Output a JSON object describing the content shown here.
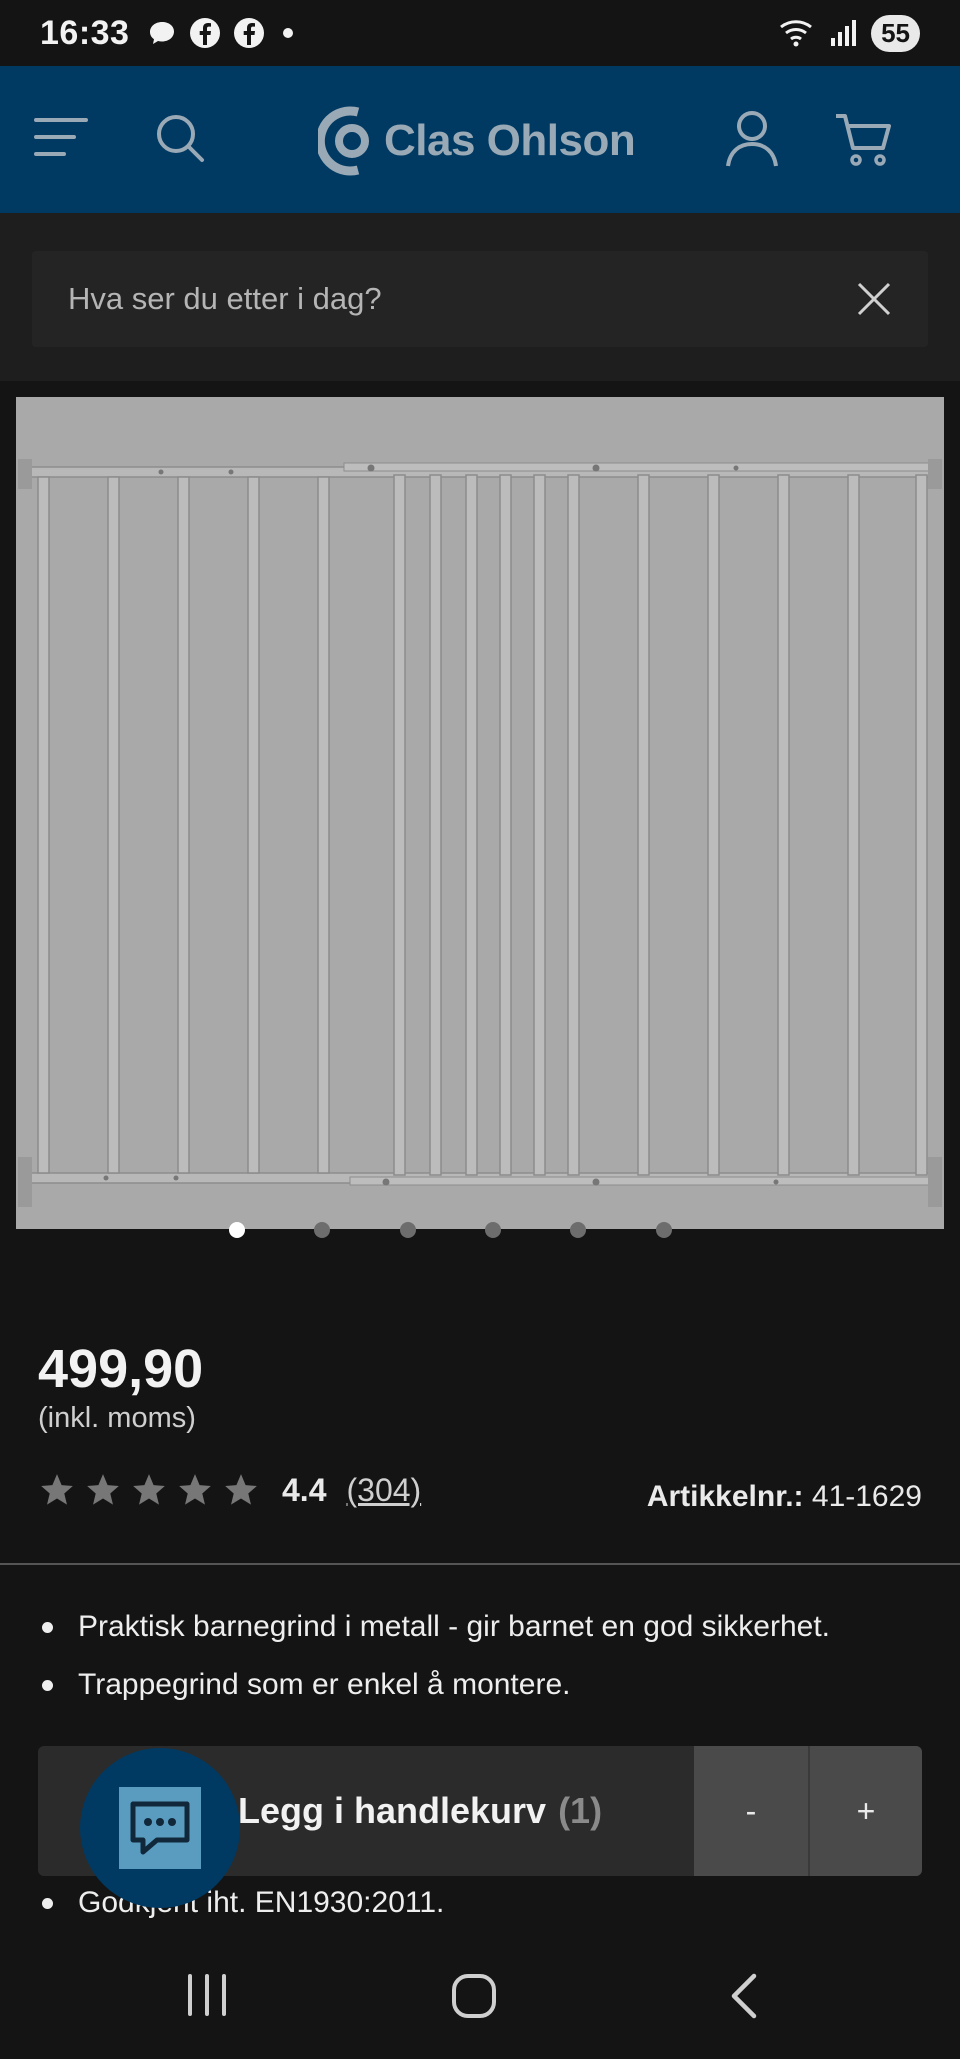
{
  "status_bar": {
    "time": "16:33",
    "notification_icons": [
      "chat-bubble-icon",
      "facebook-icon",
      "facebook-icon",
      "dot-icon"
    ],
    "battery": "55"
  },
  "header": {
    "brand": "Clas Ohlson",
    "icons": [
      "menu-icon",
      "search-icon",
      "account-icon",
      "cart-icon"
    ],
    "background": "#003a63"
  },
  "search": {
    "placeholder": "Hva ser du etter i dag?"
  },
  "gallery": {
    "slide_count": 6,
    "active_index": 0
  },
  "product": {
    "price": "499,90",
    "vat_note": "(inkl. moms)",
    "rating": "4.4",
    "review_count": "(304)",
    "stars": 5,
    "article_label": "Artikkelnr.:",
    "article_number": "41-1629",
    "bullets": [
      "Praktisk barnegrind i metall - gir barnet en god sikkerhet.",
      "Trappegrind som er enkel å montere."
    ],
    "bullet_last": "Godkjent iht. EN1930:2011."
  },
  "cart": {
    "label": "Legg i handlekurv",
    "count": "(1)",
    "minus": "-",
    "plus": "+"
  }
}
